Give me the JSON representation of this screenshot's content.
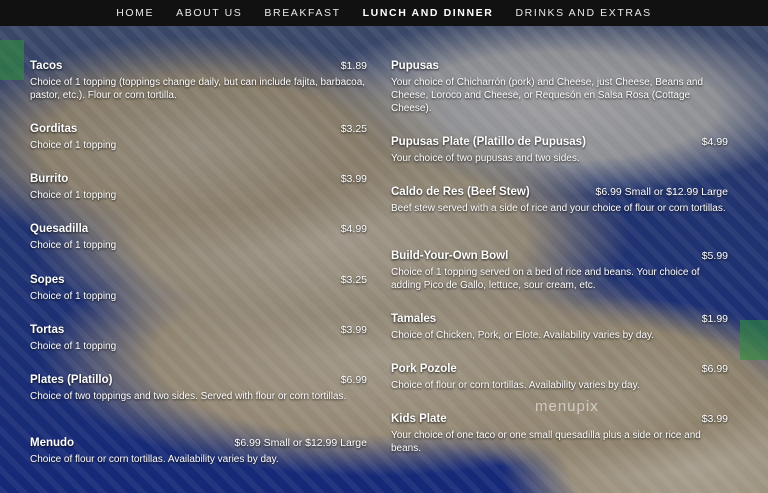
{
  "nav": {
    "items": [
      {
        "label": "HOME"
      },
      {
        "label": "ABOUT US"
      },
      {
        "label": "BREAKFAST"
      },
      {
        "label": "LUNCH AND DINNER"
      },
      {
        "label": "DRINKS AND EXTRAS"
      }
    ],
    "active_index": 3
  },
  "menu": {
    "left": [
      {
        "name": "Tacos",
        "price": "$1.89",
        "desc": "Choice of 1 topping (toppings change daily, but can include fajita, barbacoa, pastor, etc.). Flour or corn tortilla."
      },
      {
        "name": "Gorditas",
        "price": "$3.25",
        "desc": "Choice of 1 topping"
      },
      {
        "name": "Burrito",
        "price": "$3.99",
        "desc": "Choice of 1 topping"
      },
      {
        "name": "Quesadilla",
        "price": "$4.99",
        "desc": "Choice of 1 topping"
      },
      {
        "name": "Sopes",
        "price": "$3.25",
        "desc": "Choice of 1 topping"
      },
      {
        "name": "Tortas",
        "price": "$3.99",
        "desc": "Choice of 1 topping"
      },
      {
        "name": "Plates (Platillo)",
        "price": "$6.99",
        "desc": "Choice of two toppings and two sides. Served with flour or corn tortillas."
      },
      {
        "name": "Menudo",
        "price": "$6.99 Small or $12.99 Large",
        "desc": "Choice of flour or corn tortillas. Availability varies by day."
      }
    ],
    "right": [
      {
        "name": "Pupusas",
        "price": "",
        "desc": "Your choice of Chicharrón (pork) and Cheese, just Cheese, Beans and Cheese, Loroco and Cheese, or Requesón en Salsa Rosa (Cottage Cheese)."
      },
      {
        "name": "Pupusas Plate (Platillo de Pupusas)",
        "price": "$4.99",
        "desc": "Your choice of two pupusas and two sides."
      },
      {
        "name": "Caldo de Res (Beef Stew)",
        "price": "$6.99 Small or $12.99 Large",
        "desc": "Beef stew served with a side of rice and your choice of flour or corn tortillas."
      },
      {
        "name": "Build-Your-Own Bowl",
        "price": "$5.99",
        "desc": "Choice of 1 topping served on a bed of rice and beans. Your choice of adding Pico de Gallo, lettuce, sour cream, etc."
      },
      {
        "name": "Tamales",
        "price": "$1.99",
        "desc": "Choice of Chicken, Pork, or Elote. Availability varies by day."
      },
      {
        "name": "Pork Pozole",
        "price": "$6.99",
        "desc": "Choice of flour or corn tortillas. Availability varies by day."
      },
      {
        "name": "Kids Plate",
        "price": "$3.99",
        "desc": "Your choice of one taco or one small quesadilla plus a side or rice and beans."
      }
    ]
  },
  "watermark": "menupix"
}
